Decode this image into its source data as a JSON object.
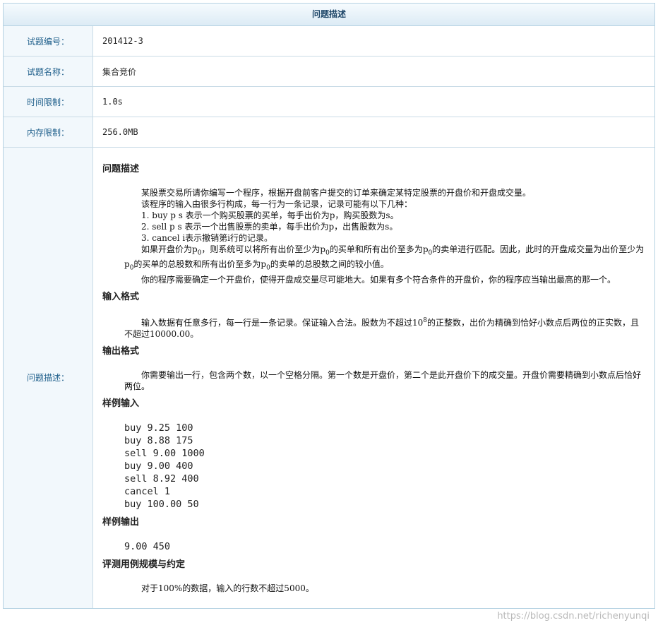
{
  "header": {
    "title": "问题描述"
  },
  "rows": [
    {
      "label": "试题编号：",
      "value": "201412-3"
    },
    {
      "label": "试题名称：",
      "value": "集合竞价"
    },
    {
      "label": "时间限制：",
      "value": "1.0s"
    },
    {
      "label": "内存限制：",
      "value": "256.0MB"
    }
  ],
  "desc_label": "问题描述：",
  "sections": {
    "problem": {
      "title": "问题描述",
      "lines": [
        "某股票交易所请你编写一个程序，根据开盘前客户提交的订单来确定某特定股票的开盘价和开盘成交量。",
        "该程序的输入由很多行构成，每一行为一条记录，记录可能有以下几种：",
        "1. buy p s 表示一个购买股票的买单，每手出价为p，购买股数为s。",
        "2. sell p s 表示一个出售股票的卖单，每手出价为p，出售股数为s。",
        "3. cancel i表示撤销第i行的记录。"
      ],
      "p0_sentence": {
        "a": "如果开盘价为p",
        "b": "，则系统可以将所有出价至少为p",
        "c": "的买单和所有出价至多为p",
        "d": "的卖单进行匹配。因此，此时的开盘成交量为出价至少为p",
        "e": "的买单的总股数和所有出价至多为p",
        "f": "的卖单的总股数之间的较小值。",
        "sub": "0"
      },
      "last_line": "你的程序需要确定一个开盘价，使得开盘成交量尽可能地大。如果有多个符合条件的开盘价，你的程序应当输出最高的那一个。"
    },
    "input_format": {
      "title": "输入格式",
      "text_a": "输入数据有任意多行，每一行是一条记录。保证输入合法。股数为不超过10",
      "sup": "8",
      "text_b": "的正整数，出价为精确到恰好小数点后两位的正实数，且不超过10000.00。"
    },
    "output_format": {
      "title": "输出格式",
      "text": "你需要输出一行，包含两个数，以一个空格分隔。第一个数是开盘价，第二个是此开盘价下的成交量。开盘价需要精确到小数点后恰好两位。"
    },
    "sample_input": {
      "title": "样例输入",
      "lines": [
        "buy 9.25 100",
        "buy 8.88 175",
        "sell 9.00 1000",
        "buy 9.00 400",
        "sell 8.92 400",
        "cancel 1",
        "buy 100.00 50"
      ]
    },
    "sample_output": {
      "title": "样例输出",
      "lines": [
        "9.00 450"
      ]
    },
    "constraints": {
      "title": "评测用例规模与约定",
      "text": "对于100%的数据，输入的行数不超过5000。"
    }
  },
  "watermark": "https://blog.csdn.net/richenyunqi"
}
